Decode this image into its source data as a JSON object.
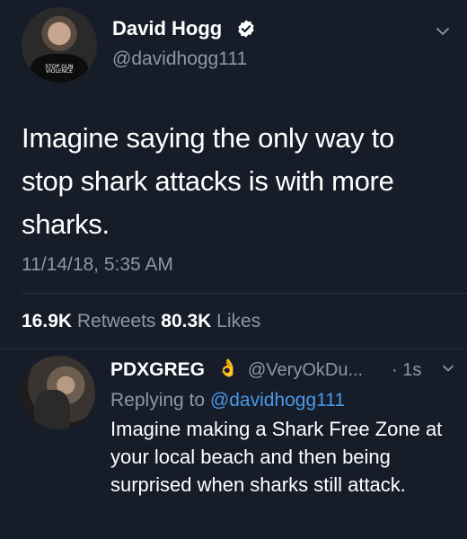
{
  "main_tweet": {
    "display_name": "David Hogg",
    "handle": "@davidhogg111",
    "avatar_shirt_text": "STOP GUN VIOLENCE",
    "text": "Imagine saying the only way to stop shark attacks is with more sharks.",
    "timestamp": "11/14/18, 5:35 AM",
    "retweets_count": "16.9K",
    "retweets_label": "Retweets",
    "likes_count": "80.3K",
    "likes_label": "Likes"
  },
  "reply": {
    "display_name": "PDXGREG",
    "emoji": "👌",
    "handle": "@VeryOkDu...",
    "time": "· 1s",
    "replying_prefix": "Replying to",
    "replying_to": "@davidhogg111",
    "text": "Imagine making a Shark Free Zone at your local beach and then being surprised when sharks still attack."
  },
  "colors": {
    "background": "#161d29",
    "text": "#ffffff",
    "secondary": "#8b98a5",
    "link": "#4a99e9",
    "verified": "#ffffff"
  },
  "icons": [
    "verified-badge-icon",
    "chevron-down-icon"
  ]
}
